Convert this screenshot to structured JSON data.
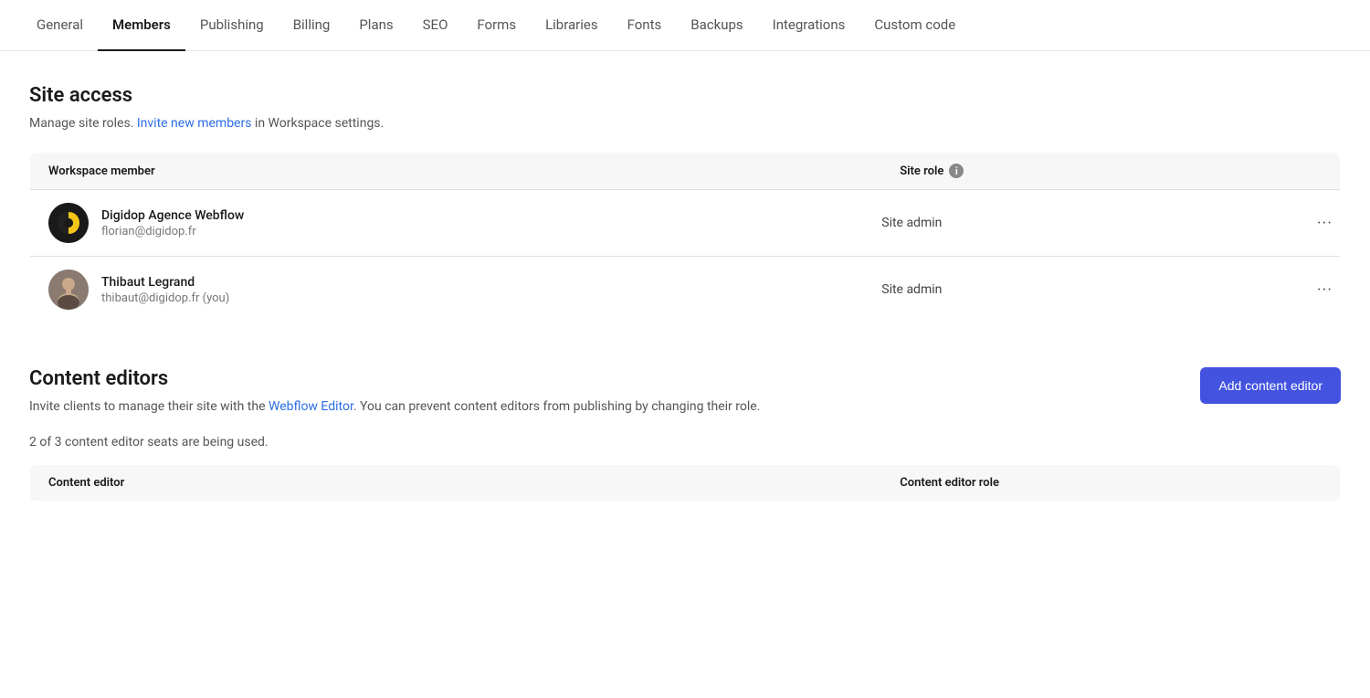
{
  "nav": {
    "tabs": [
      {
        "id": "general",
        "label": "General",
        "active": false
      },
      {
        "id": "members",
        "label": "Members",
        "active": true
      },
      {
        "id": "publishing",
        "label": "Publishing",
        "active": false
      },
      {
        "id": "billing",
        "label": "Billing",
        "active": false
      },
      {
        "id": "plans",
        "label": "Plans",
        "active": false
      },
      {
        "id": "seo",
        "label": "SEO",
        "active": false
      },
      {
        "id": "forms",
        "label": "Forms",
        "active": false
      },
      {
        "id": "libraries",
        "label": "Libraries",
        "active": false
      },
      {
        "id": "fonts",
        "label": "Fonts",
        "active": false
      },
      {
        "id": "backups",
        "label": "Backups",
        "active": false
      },
      {
        "id": "integrations",
        "label": "Integrations",
        "active": false
      },
      {
        "id": "custom-code",
        "label": "Custom code",
        "active": false
      }
    ]
  },
  "site_access": {
    "title": "Site access",
    "description_prefix": "Manage site roles. ",
    "invite_link_text": "Invite new members",
    "description_suffix": " in Workspace settings.",
    "table": {
      "col_member": "Workspace member",
      "col_role": "Site role",
      "members": [
        {
          "id": "digidop",
          "name": "Digidop Agence Webflow",
          "email": "florian@digidop.fr",
          "role": "Site admin",
          "avatar_type": "logo"
        },
        {
          "id": "thibaut",
          "name": "Thibaut Legrand",
          "email": "thibaut@digidop.fr (you)",
          "role": "Site admin",
          "avatar_type": "photo"
        }
      ]
    }
  },
  "content_editors": {
    "title": "Content editors",
    "description_prefix": "Invite clients to manage their site with the ",
    "editor_link_text": "Webflow Editor",
    "description_suffix": ". You can prevent content editors from publishing by changing their role.",
    "seats_info": "2 of 3 content editor seats are being used.",
    "add_button_label": "Add content editor",
    "table": {
      "col_editor": "Content editor",
      "col_role": "Content editor role"
    }
  },
  "colors": {
    "accent_blue": "#2b6de8",
    "btn_primary": "#4353e0",
    "active_tab_border": "#1a1a1a"
  }
}
